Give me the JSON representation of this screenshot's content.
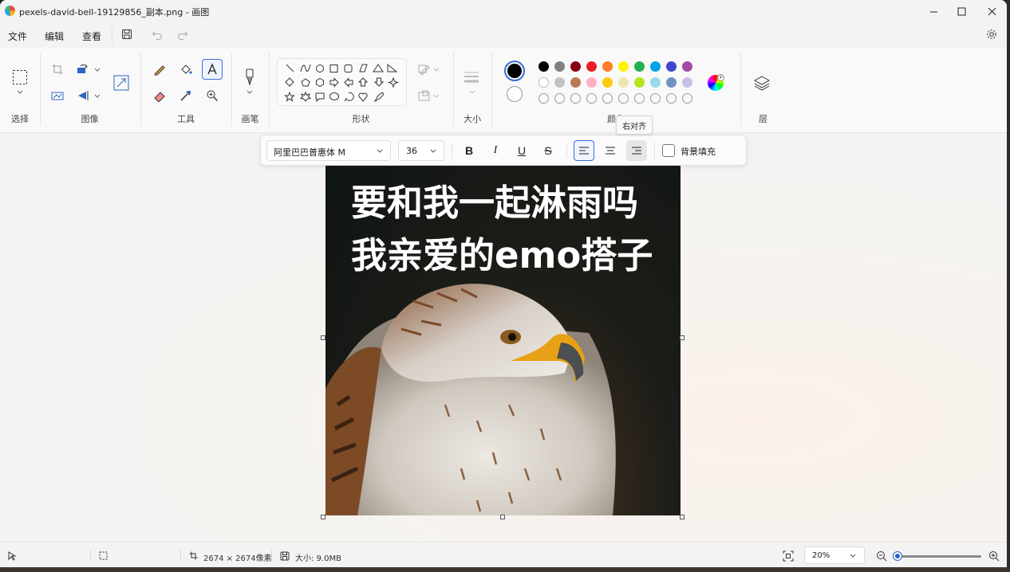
{
  "window": {
    "title": "pexels-david-bell-19129856_副本.png - 画图"
  },
  "menu": {
    "file": "文件",
    "edit": "编辑",
    "view": "查看"
  },
  "ribbon": {
    "groups": {
      "select": "选择",
      "image": "图像",
      "tools": "工具",
      "brush": "画笔",
      "shapes": "形状",
      "size": "大小",
      "colors": "颜色",
      "layers": "层"
    },
    "tooltip": "右对齐",
    "palette_row1": [
      "#000000",
      "#7f7f7f",
      "#880015",
      "#ed1c24",
      "#ff7f27",
      "#fff200",
      "#22b14c",
      "#00a2e8",
      "#3f48cc",
      "#a349a4"
    ],
    "palette_row2": [
      "#ffffff",
      "#c3c3c3",
      "#b97a57",
      "#ffaec9",
      "#ffc90e",
      "#efe4b0",
      "#b5e61d",
      "#99d9ea",
      "#7092be",
      "#c8bfe7"
    ],
    "primary_color": "#000000",
    "secondary_color": "#ffffff"
  },
  "text_toolbar": {
    "font_name": "阿里巴巴普惠体 M",
    "font_size": "36",
    "bold": "B",
    "italic": "I",
    "underline": "U",
    "strikethrough": "S",
    "background_fill": "背景填充"
  },
  "canvas": {
    "line1": "要和我一起淋雨吗",
    "line2": "我亲爱的emo搭子"
  },
  "status": {
    "dimensions": "2674 × 2674像素",
    "file_size": "大小: 9.0MB",
    "zoom": "20%",
    "zoom_fraction": 0.2
  }
}
